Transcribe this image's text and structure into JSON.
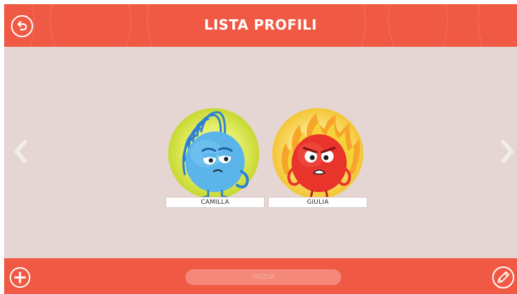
{
  "header": {
    "title": "LISTA PROFILI",
    "back_icon": "back-arrow-icon"
  },
  "profiles": [
    {
      "name": "CAMILLA",
      "avatar": "blue-water-drop-character",
      "ring_color": "#c9d936"
    },
    {
      "name": "GIULIA",
      "avatar": "red-fire-character",
      "ring_color": "#f6cc3c"
    }
  ],
  "navigation": {
    "prev_icon": "chevron-left-icon",
    "next_icon": "chevron-right-icon"
  },
  "footer": {
    "start_label": "INIZIA",
    "start_enabled": false,
    "add_icon": "plus-icon",
    "edit_icon": "pencil-icon"
  },
  "colors": {
    "primary": "#f05a45",
    "background": "#e5d6d4",
    "start_disabled": "#f4897a"
  }
}
